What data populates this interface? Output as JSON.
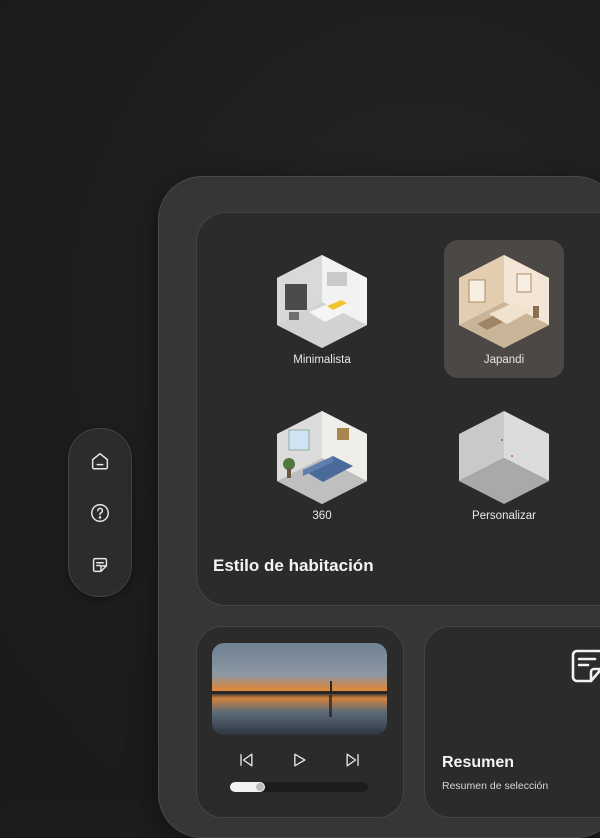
{
  "rail": {
    "items": [
      {
        "icon": "home-icon"
      },
      {
        "icon": "help-icon"
      },
      {
        "icon": "note-icon"
      }
    ]
  },
  "room_style": {
    "title": "Estilo de habitación",
    "options": [
      {
        "label": "Minimalista",
        "selected": false
      },
      {
        "label": "Japandi",
        "selected": true
      },
      {
        "label": "360",
        "selected": false
      },
      {
        "label": "Personalizar",
        "selected": false
      }
    ]
  },
  "player": {
    "progress": 0.25
  },
  "summary": {
    "title": "Resumen",
    "subtitle": "Resumen de selección",
    "icon": "note-icon"
  },
  "colors": {
    "background": "#1d1d1d",
    "card": "#2b2b2b",
    "selected": "#4b4846"
  }
}
